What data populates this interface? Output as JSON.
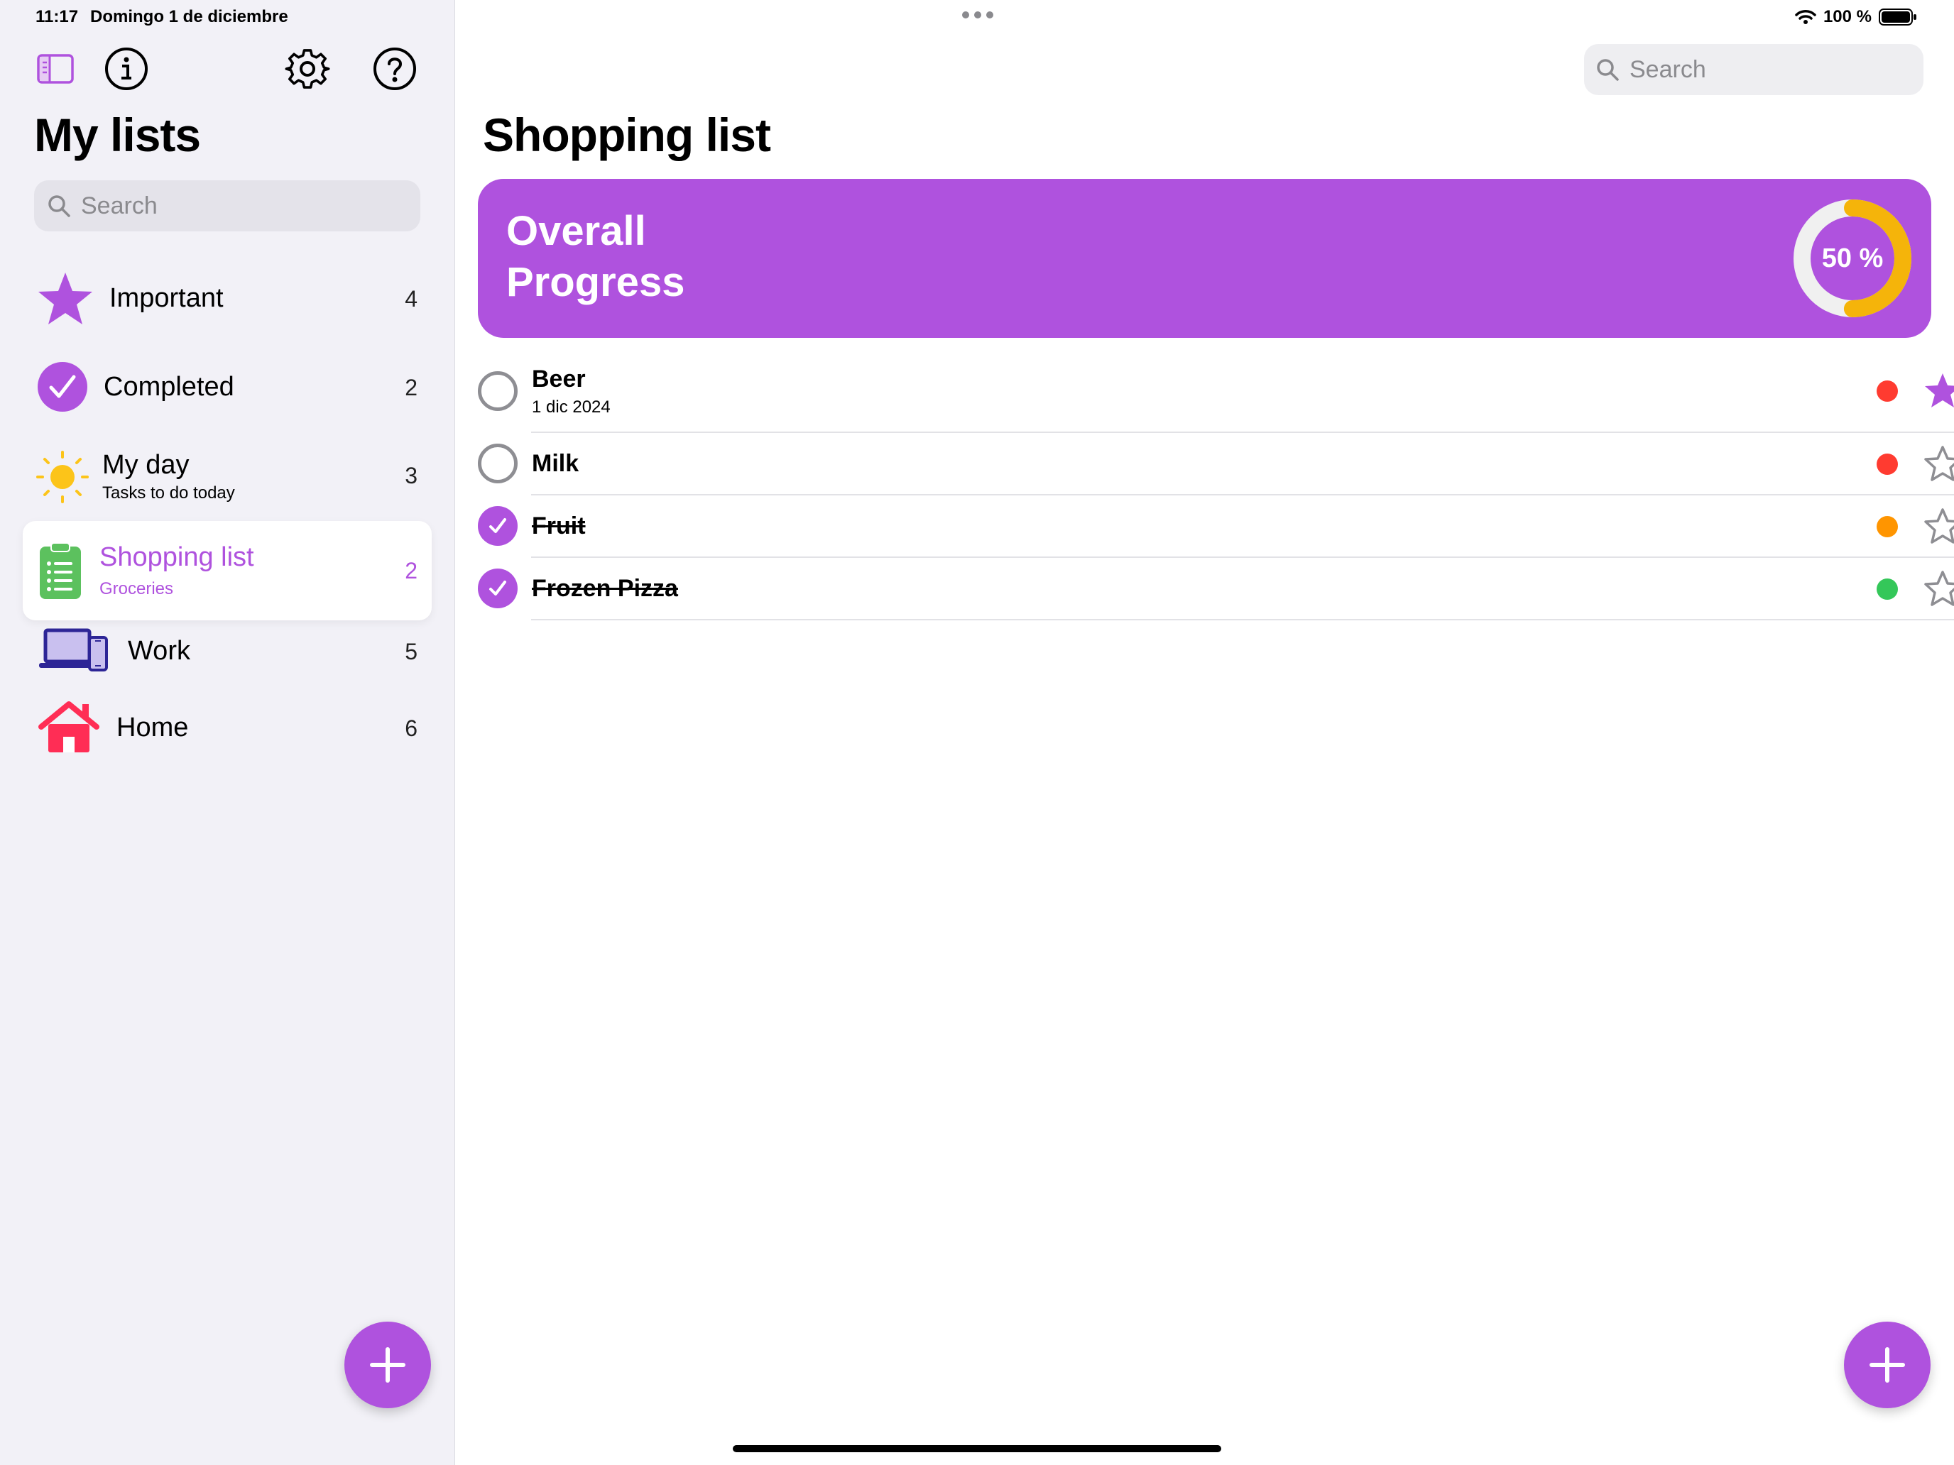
{
  "status": {
    "time": "11:17",
    "date": "Domingo 1 de diciembre",
    "battery": "100 %"
  },
  "colors": {
    "accent": "#af52de",
    "sidebar_bg": "#f2f1f7",
    "ring_track": "#f0f0f0",
    "ring_fill": "#f5b40a"
  },
  "sidebar": {
    "title": "My lists",
    "search_placeholder": "Search",
    "toolbar_icons": [
      "sidebar-toggle-icon",
      "info-icon",
      "gear-icon",
      "help-icon"
    ],
    "lists": [
      {
        "label": "Important",
        "subtitle": "",
        "count": "4",
        "icon": "star-icon"
      },
      {
        "label": "Completed",
        "subtitle": "",
        "count": "2",
        "icon": "checkmark-circle-icon"
      },
      {
        "label": "My day",
        "subtitle": "Tasks to do today",
        "count": "3",
        "icon": "sun-icon"
      },
      {
        "label": "Shopping list",
        "subtitle": "Groceries",
        "count": "2",
        "icon": "clipboard-list-icon",
        "selected": true
      },
      {
        "label": "Work",
        "subtitle": "",
        "count": "5",
        "icon": "laptop-phone-icon"
      },
      {
        "label": "Home",
        "subtitle": "",
        "count": "6",
        "icon": "house-icon"
      }
    ],
    "add_button_icon": "plus-icon"
  },
  "main": {
    "search_placeholder": "Search",
    "title": "Shopping list",
    "progress": {
      "label": "Overall Progress",
      "value_text": "50 %",
      "value": 0.5
    },
    "tasks": [
      {
        "title": "Beer",
        "date": "1 dic 2024",
        "completed": false,
        "priority_color": "#ff3b30",
        "starred": true
      },
      {
        "title": "Milk",
        "date": "",
        "completed": false,
        "priority_color": "#ff3b30",
        "starred": false
      },
      {
        "title": "Fruit",
        "date": "",
        "completed": true,
        "priority_color": "#ff9500",
        "starred": false
      },
      {
        "title": "Frozen Pizza",
        "date": "",
        "completed": true,
        "priority_color": "#34c759",
        "starred": false
      }
    ],
    "add_button_icon": "plus-icon"
  }
}
